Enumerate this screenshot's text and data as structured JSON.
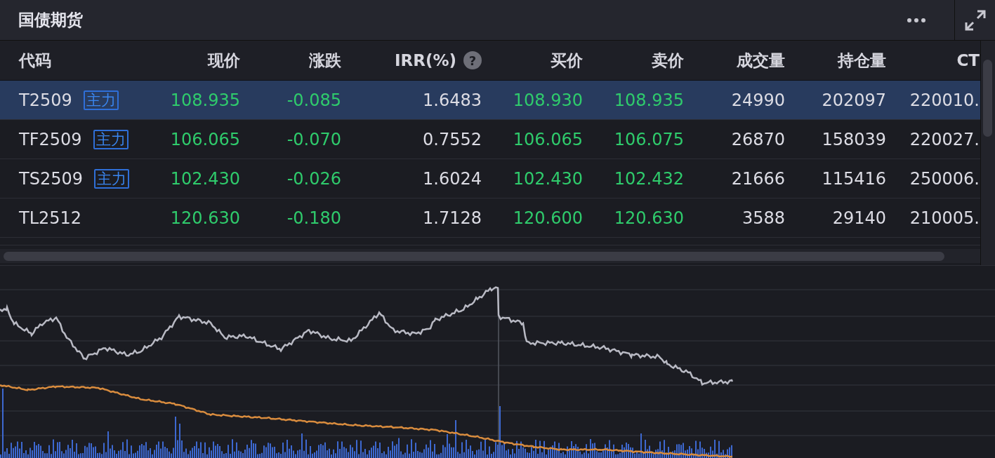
{
  "panel": {
    "title": "国债期货"
  },
  "table": {
    "columns": [
      {
        "label": "代码"
      },
      {
        "label": "现价"
      },
      {
        "label": "涨跌"
      },
      {
        "label": "IRR(%)",
        "help": "?"
      },
      {
        "label": "买价"
      },
      {
        "label": "卖价"
      },
      {
        "label": "成交量"
      },
      {
        "label": "持仓量"
      },
      {
        "label": "CT"
      }
    ],
    "rows": [
      {
        "selected": true,
        "tag": "主力",
        "cells": [
          "T2509",
          "108.935",
          "-0.085",
          "1.6483",
          "108.930",
          "108.935",
          "24990",
          "202097",
          "220010."
        ]
      },
      {
        "selected": false,
        "tag": "主力",
        "cells": [
          "TF2509",
          "106.065",
          "-0.070",
          "0.7552",
          "106.065",
          "106.075",
          "26870",
          "158039",
          "220027."
        ]
      },
      {
        "selected": false,
        "tag": "主力",
        "cells": [
          "TS2509",
          "102.430",
          "-0.026",
          "1.6024",
          "102.430",
          "102.432",
          "21666",
          "115416",
          "250006."
        ]
      },
      {
        "selected": false,
        "cells": [
          "TL2512",
          "120.630",
          "-0.180",
          "1.7128",
          "120.600",
          "120.630",
          "3588",
          "29140",
          "210005."
        ]
      }
    ]
  }
}
